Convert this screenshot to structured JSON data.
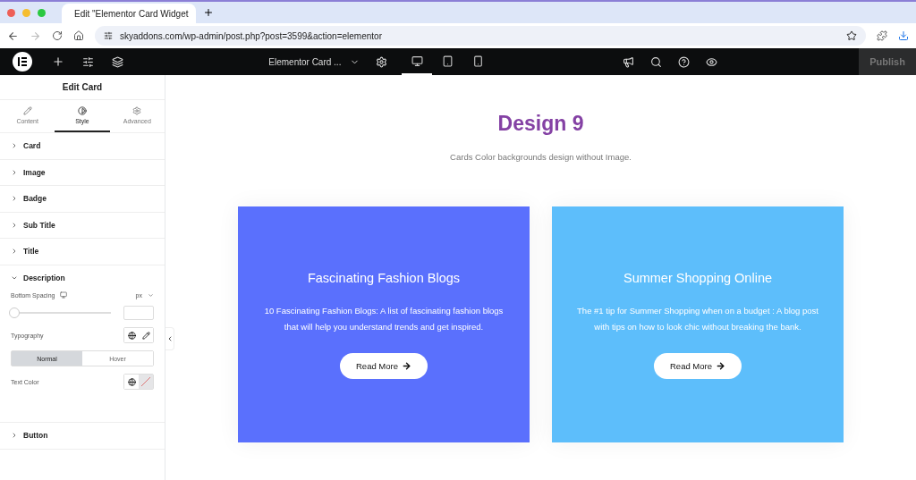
{
  "browser": {
    "tab_title": "Edit \"Elementor Card Widget",
    "url": "skyaddons.com/wp-admin/post.php?post=3599&action=elementor"
  },
  "topbar": {
    "document_title": "Elementor Card ...",
    "devices": [
      {
        "kind": "desktop",
        "selected": true
      },
      {
        "kind": "tablet",
        "selected": false
      },
      {
        "kind": "mobile",
        "selected": false
      }
    ],
    "publish": "Publish"
  },
  "panel": {
    "title": "Edit Card",
    "tabs": [
      {
        "kind": "content",
        "label": "Content",
        "selected": false
      },
      {
        "kind": "style",
        "label": "Style",
        "selected": true
      },
      {
        "kind": "advanced",
        "label": "Advanced",
        "selected": false
      }
    ],
    "sections": [
      {
        "label": "Card",
        "expanded": false
      },
      {
        "label": "Image",
        "expanded": false
      },
      {
        "label": "Badge",
        "expanded": false
      },
      {
        "label": "Sub Title",
        "expanded": false
      },
      {
        "label": "Title",
        "expanded": false
      },
      {
        "label": "Description",
        "expanded": true
      },
      {
        "label": "Button",
        "expanded": false
      }
    ],
    "controls": {
      "spacing_label": "Bottom Spacing",
      "unit": "px",
      "level": 0,
      "typography_label": "Typography",
      "states": [
        {
          "label": "Normal",
          "selected": true
        },
        {
          "label": "Hover",
          "selected": false
        }
      ],
      "color_label": "Text Color"
    }
  },
  "canvas": {
    "heading": "Design 9",
    "subtitle": "Cards Color backgrounds design without Image.",
    "cards": [
      {
        "title": "Fascinating Fashion Blogs",
        "text": "10 Fascinating Fashion Blogs: A list of fascinating fashion blogs that will help you understand trends and get inspired.",
        "button": "Read More",
        "color": "#5a70fd"
      },
      {
        "title": "Summer Shopping Online",
        "text": "The #1 tip for Summer Shopping when on a budget : A blog post with tips on how to look chic without breaking the bank.",
        "button": "Read More",
        "color": "#5dbefb"
      }
    ]
  }
}
